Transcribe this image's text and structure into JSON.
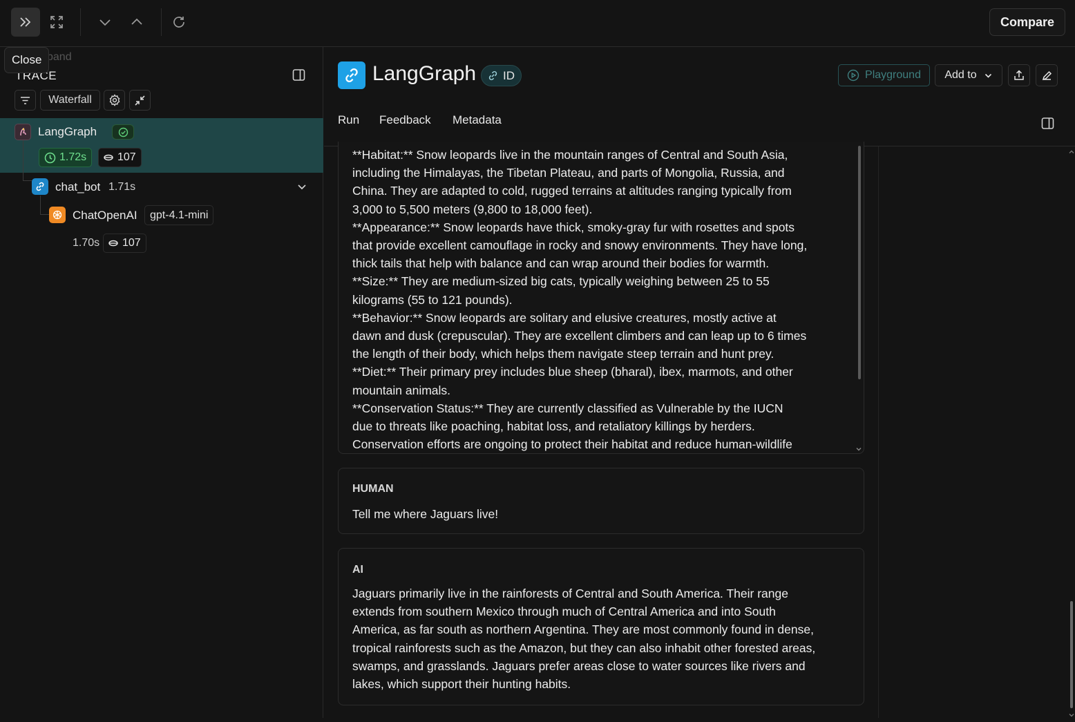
{
  "topbar": {
    "compare_label": "Compare",
    "icons": [
      "double-chevron-right-icon",
      "expand-icon",
      "chevron-down-icon",
      "chevron-up-icon",
      "refresh-icon"
    ]
  },
  "tooltip": {
    "text": "Close"
  },
  "ghost_text": "pand",
  "trace": {
    "title": "TRACE",
    "view_label": "Waterfall",
    "nodes": [
      {
        "name": "LangGraph",
        "latency": "1.72s",
        "tokens": "107",
        "status": "success"
      },
      {
        "name": "chat_bot",
        "latency": "1.71s"
      },
      {
        "name": "ChatOpenAI",
        "model": "gpt-4.1-mini",
        "latency": "1.70s",
        "tokens": "107"
      }
    ]
  },
  "run": {
    "title": "LangGraph",
    "id_label": "ID",
    "playground_label": "Playground",
    "add_to_label": "Add to"
  },
  "tabs": [
    "Run",
    "Feedback",
    "Metadata"
  ],
  "messages": {
    "ai_partial": "**Habitat:** Snow leopards live in the mountain ranges of Central and South Asia,\nincluding the Himalayas, the Tibetan Plateau, and parts of Mongolia, Russia, and\nChina. They are adapted to cold, rugged terrains at altitudes ranging typically from\n3,000 to 5,500 meters (9,800 to 18,000 feet).\n**Appearance:** Snow leopards have thick, smoky-gray fur with rosettes and spots\nthat provide excellent camouflage in rocky and snowy environments. They have long,\nthick tails that help with balance and can wrap around their bodies for warmth.\n**Size:** They are medium-sized big cats, typically weighing between 25 to 55\nkilograms (55 to 121 pounds).\n**Behavior:** Snow leopards are solitary and elusive creatures, mostly active at\ndawn and dusk (crepuscular). They are excellent climbers and can leap up to 6 times\nthe length of their body, which helps them navigate steep terrain and hunt prey.\n**Diet:** Their primary prey includes blue sheep (bharal), ibex, marmots, and other\nmountain animals.\n**Conservation Status:** They are currently classified as Vulnerable by the IUCN\ndue to threats like poaching, habitat loss, and retaliatory killings by herders.\nConservation efforts are ongoing to protect their habitat and reduce human-wildlife",
    "human_role": "HUMAN",
    "human_text": "Tell me where Jaguars live!",
    "ai_role": "AI",
    "ai_text": "Jaguars primarily live in the rainforests of Central and South America. Their range\nextends from southern Mexico through much of Central America and into South\nAmerica, as far south as northern Argentina. They are most commonly found in dense,\ntropical rainforests such as the Amazon, but they can also inhabit other forested areas,\nswamps, and grasslands. Jaguars prefer areas close to water sources like rivers and\nlakes, which support their hunting habits."
  }
}
